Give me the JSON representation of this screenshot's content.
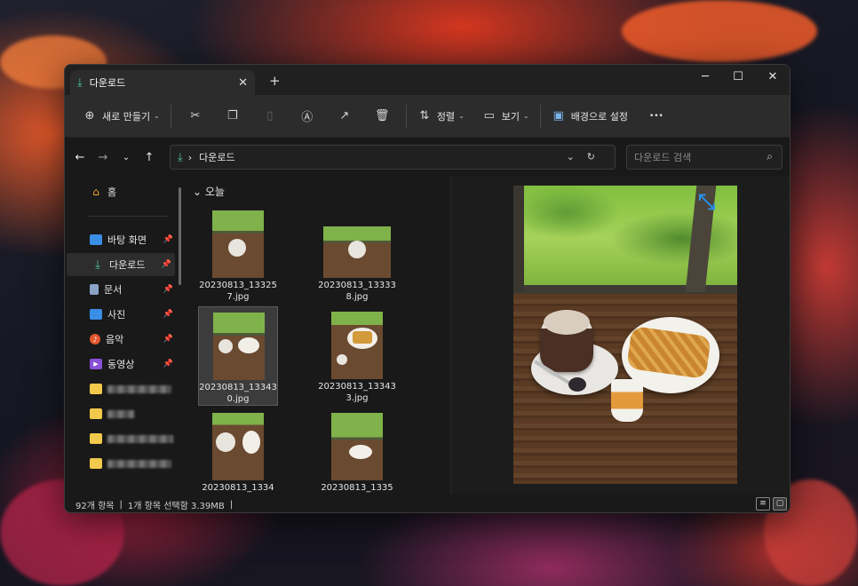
{
  "window": {
    "tab_title": "다운로드",
    "new_tab": "+",
    "minimize": "─",
    "maximize": "☐",
    "close": "✕"
  },
  "toolbar": {
    "new_label": "새로 만들기",
    "sort_label": "정렬",
    "view_label": "보기",
    "wallpaper_label": "배경으로 설정",
    "more": "•••"
  },
  "nav": {
    "address_folder": "다운로드",
    "address_sep": "›",
    "search_placeholder": "다운로드 검색"
  },
  "sidebar": {
    "home": "홈",
    "quick": [
      {
        "label": "바탕 화면",
        "icon": "desktop-icon",
        "color": "#3a8ee6"
      },
      {
        "label": "다운로드",
        "icon": "download-icon",
        "color": "#4cc2a5"
      },
      {
        "label": "문서",
        "icon": "document-icon",
        "color": "#8aa4c8"
      },
      {
        "label": "사진",
        "icon": "picture-icon",
        "color": "#3a8ee6"
      },
      {
        "label": "음악",
        "icon": "music-icon",
        "color": "#e4572e"
      },
      {
        "label": "동영상",
        "icon": "video-icon",
        "color": "#8a4fd8"
      }
    ]
  },
  "files": {
    "group": "오늘",
    "items": [
      {
        "name": "20230813_133257.jpg"
      },
      {
        "name": "20230813_133338.jpg"
      },
      {
        "name": "20230813_133430.jpg"
      },
      {
        "name": "20230813_133433.jpg"
      },
      {
        "name": "20230813_1334"
      },
      {
        "name": "20230813_1335"
      }
    ]
  },
  "status": {
    "count": "92개 항목",
    "selection": "1개 항목 선택함 3.39MB"
  },
  "colors": {
    "accent": "#4cc2a5",
    "folder": "#f2c94c"
  }
}
